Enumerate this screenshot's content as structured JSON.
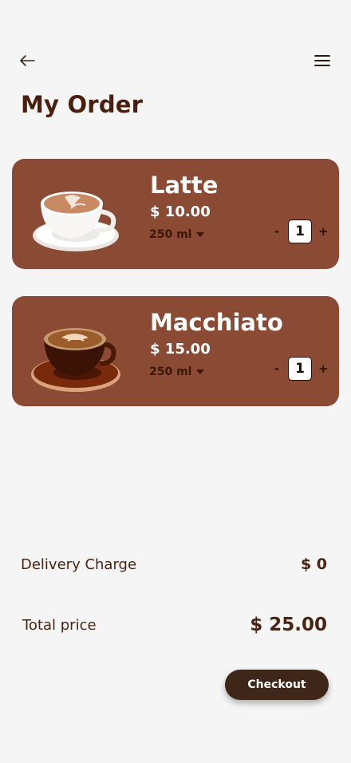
{
  "header": {
    "back_icon": "arrow-left-icon",
    "menu_icon": "hamburger-menu-icon",
    "title": "My Order"
  },
  "items": [
    {
      "name": "Latte",
      "price": "$ 10.00",
      "size": "250 ml",
      "quantity": "1",
      "minus": "-",
      "plus": "+",
      "image": "latte-cup-image"
    },
    {
      "name": "Macchiato",
      "price": "$ 15.00",
      "size": "250 ml",
      "quantity": "1",
      "minus": "-",
      "plus": "+",
      "image": "macchiato-cup-image"
    }
  ],
  "summary": {
    "delivery_label": "Delivery Charge",
    "delivery_value": "$ 0",
    "total_label": "Total price",
    "total_value": "$ 25.00"
  },
  "checkout_label": "Checkout",
  "colors": {
    "background": "#f5f5f5",
    "card": "#8a4a33",
    "text": "#4a2410",
    "button": "#3e2618"
  }
}
